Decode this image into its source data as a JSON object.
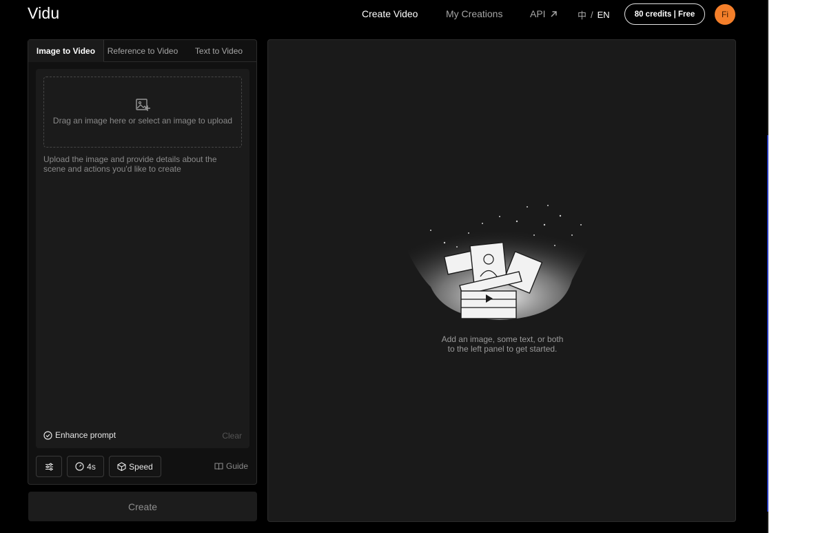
{
  "header": {
    "logo": "Vidu",
    "nav": {
      "create_video": "Create Video",
      "my_creations": "My Creations",
      "api": "API"
    },
    "lang": {
      "zh": "中",
      "sep": "/",
      "en": "EN"
    },
    "credits": "80 credits | Free",
    "avatar_initials": "Fi"
  },
  "left_panel": {
    "tabs": [
      "Image to Video",
      "Reference to Video",
      "Text to Video"
    ],
    "active_tab": "Image to Video",
    "upload": {
      "text": "Drag an image here or select an image to upload"
    },
    "prompt_placeholder": "Upload the image and provide details about the scene and actions you'd like to create",
    "enhance_prompt": "Enhance prompt",
    "clear": "Clear",
    "controls": {
      "duration": "4s",
      "speed": "Speed",
      "guide": "Guide"
    },
    "create_button": "Create"
  },
  "right_panel": {
    "empty_line1": "Add an image, some text, or both",
    "empty_line2": "to the left panel to get started."
  },
  "icons": [
    "image-add-icon",
    "check-circle-icon",
    "sliders-icon",
    "clock-icon",
    "cube-icon",
    "book-icon",
    "arrow-up-right-icon",
    "play-icon"
  ],
  "colors": {
    "background": "#000000",
    "panel": "#1a1a1a",
    "avatar": "#f47f2a"
  }
}
